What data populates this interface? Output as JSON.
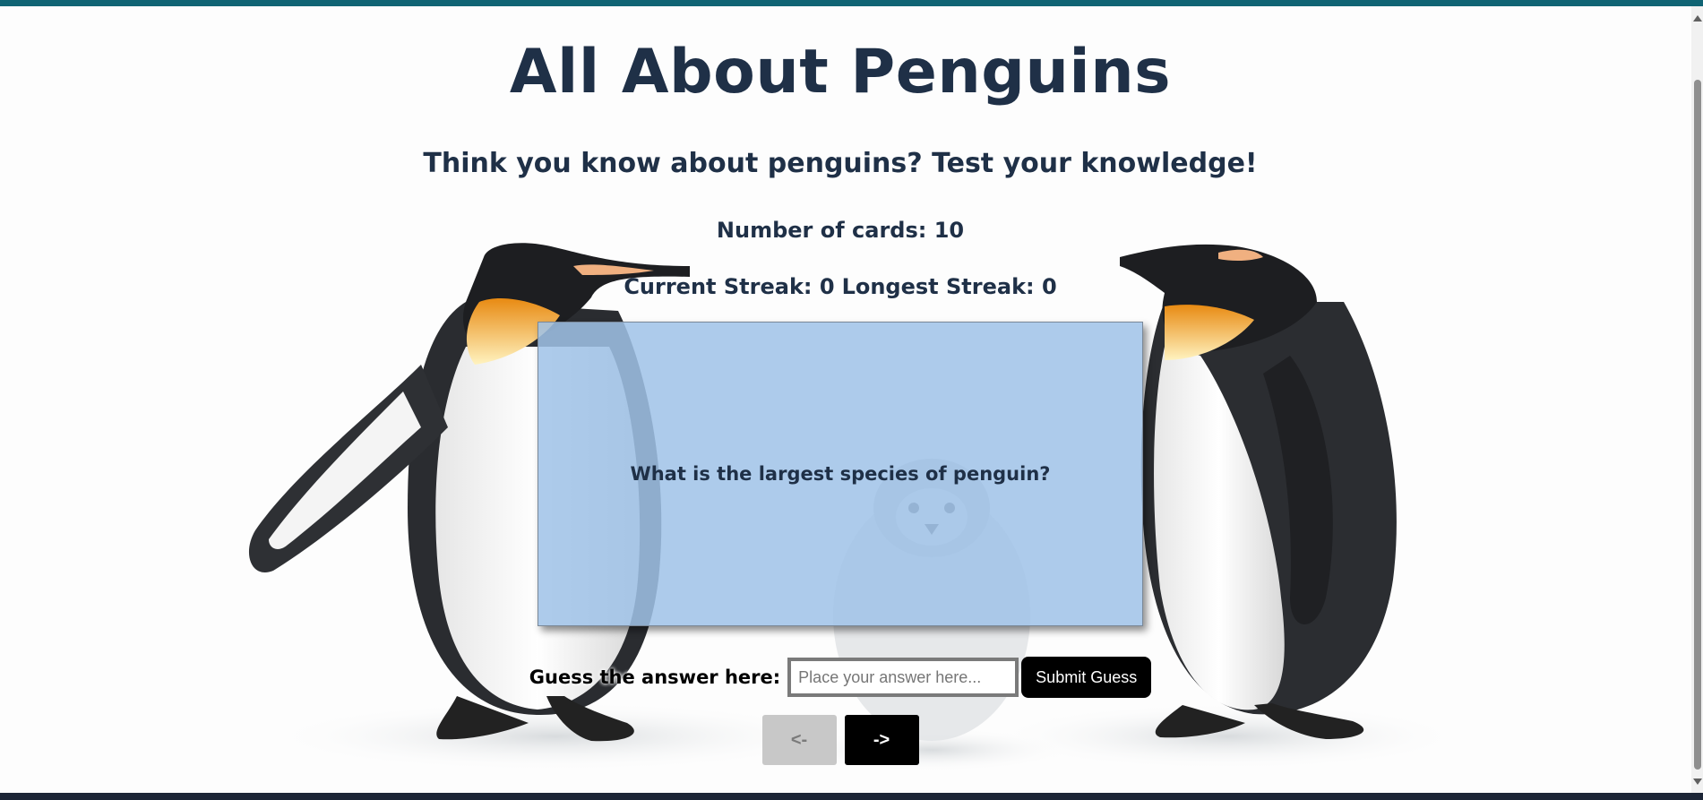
{
  "header": {
    "title": "All About Penguins",
    "subtitle": "Think you know about penguins? Test your knowledge!"
  },
  "stats": {
    "card_count": "Number of cards: 10",
    "current_streak": "Current Streak: 0",
    "longest_streak": "Longest Streak: 0"
  },
  "card": {
    "question": "What is the largest species of penguin?"
  },
  "guess": {
    "label": "Guess the answer here:",
    "placeholder": "Place your answer here...",
    "value": "",
    "submit_label": "Submit Guess"
  },
  "navigation": {
    "prev_label": "<-",
    "next_label": "->"
  },
  "colors": {
    "heading": "#1f3047",
    "card_background": "#a0c2e8",
    "top_strip": "#106474",
    "button": "#000000",
    "button_disabled": "#c8c8c8"
  },
  "icons": {
    "background": "penguins-illustration"
  }
}
